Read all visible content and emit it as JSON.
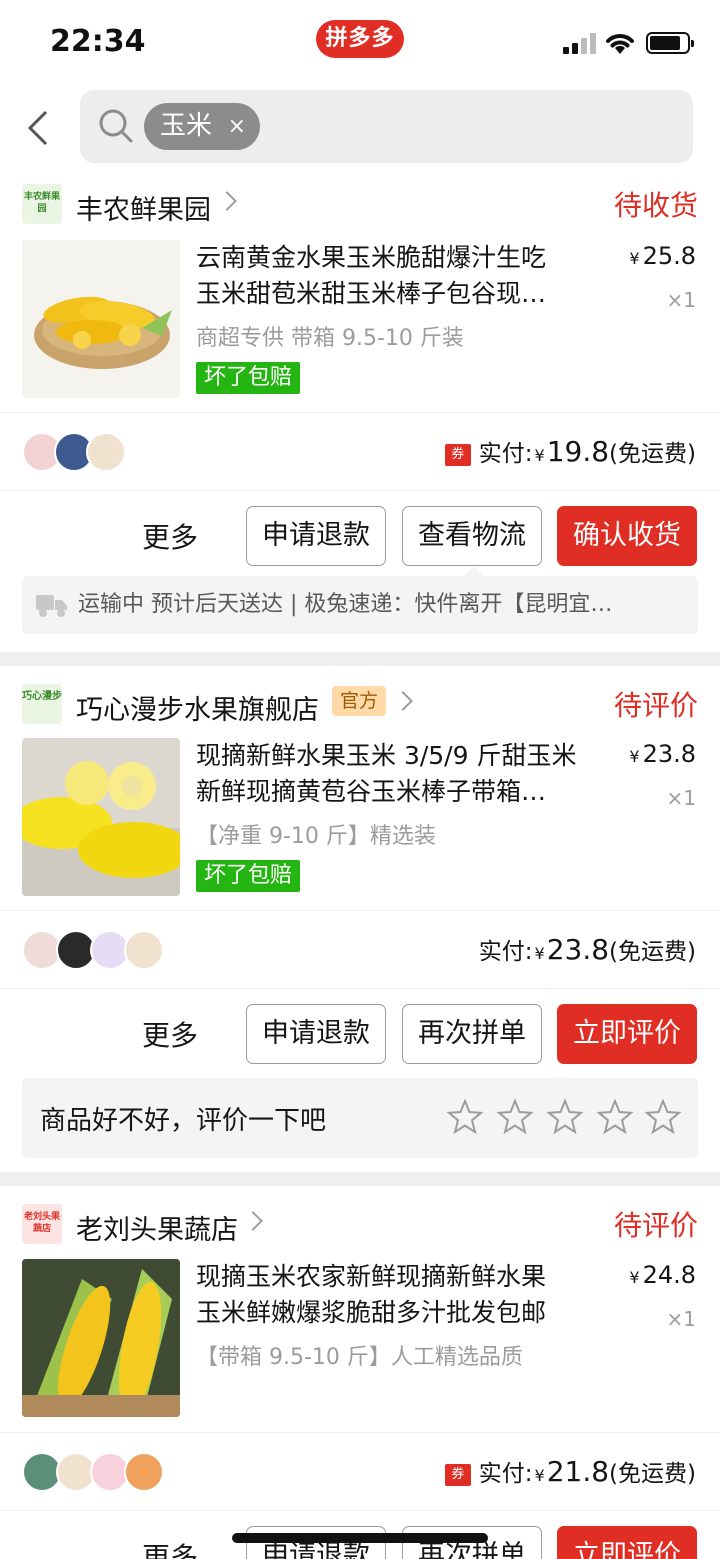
{
  "status_bar": {
    "time": "22:34",
    "app_badge": "拼多多"
  },
  "search": {
    "tag": "玉米",
    "tag_close": "×"
  },
  "orders": [
    {
      "store_name": "丰农鲜果园",
      "store_logo_text": "丰农鲜果园",
      "official": "",
      "status": "待收货",
      "title_line1": "云南黄金水果玉米脆甜爆汁生吃",
      "title_line2": "玉米甜苞米甜玉米棒子包谷现…",
      "spec": "商超专供 带箱 9.5-10 斤装",
      "badge": "坏了包赔",
      "price_symbol": "¥",
      "price": "25.8",
      "qty": "×1",
      "paid_label": "实付:",
      "paid_symbol": "¥",
      "paid_amount": "19.8",
      "paid_note": "(免运费)",
      "coupon": "券",
      "more": "更多",
      "buttons": [
        "申请退款",
        "查看物流",
        "确认收货"
      ],
      "logistics": "运输中 预计后天送达 | 极兔速递：快件离开【昆明宜…"
    },
    {
      "store_name": "巧心漫步水果旗舰店",
      "store_logo_text": "巧心漫步",
      "official": "官方",
      "status": "待评价",
      "title_line1": "现摘新鲜水果玉米 3/5/9 斤甜玉米",
      "title_line2": "新鲜现摘黄苞谷玉米棒子带箱…",
      "spec": "【净重 9-10 斤】精选装",
      "badge": "坏了包赔",
      "price_symbol": "¥",
      "price": "23.8",
      "qty": "×1",
      "paid_label": "实付:",
      "paid_symbol": "¥",
      "paid_amount": "23.8",
      "paid_note": "(免运费)",
      "more": "更多",
      "buttons": [
        "申请退款",
        "再次拼单",
        "立即评价"
      ],
      "review_prompt": "商品好不好，评价一下吧"
    },
    {
      "store_name": "老刘头果蔬店",
      "store_logo_text": "老刘头果蔬店",
      "official": "",
      "status": "待评价",
      "title_line1": "现摘玉米农家新鲜现摘新鲜水果",
      "title_line2": "玉米鲜嫩爆浆脆甜多汁批发包邮",
      "spec": "【带箱 9.5-10 斤】人工精选品质",
      "price_symbol": "¥",
      "price": "24.8",
      "qty": "×1",
      "paid_label": "实付:",
      "paid_symbol": "¥",
      "paid_amount": "21.8",
      "paid_note": "(免运费)",
      "coupon": "券",
      "more": "更多",
      "buttons": [
        "申请退款",
        "再次拼单",
        "立即评价"
      ]
    }
  ],
  "colors": {
    "accent": "#e02e24",
    "green_badge": "#25b513",
    "muted": "#9c9c9c"
  }
}
